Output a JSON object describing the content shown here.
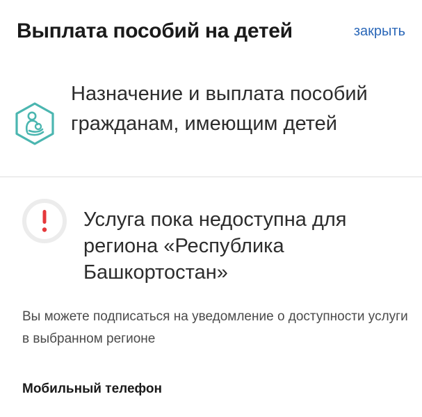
{
  "header": {
    "title": "Выплата пособий на детей",
    "close_label": "закрыть"
  },
  "service": {
    "icon": "mother-child-icon",
    "title": "Назначение и выплата пособий гражданам, имеющим детей"
  },
  "alert": {
    "icon": "exclamation-icon",
    "title": "Услуга пока недоступна для региона «Республика Башкортостан»"
  },
  "info": {
    "text": "Вы можете подписаться на уведомление о доступности услуги в выбранном регионе"
  },
  "form": {
    "phone_label": "Мобильный телефон"
  },
  "colors": {
    "accent": "#2a67b8",
    "icon_teal": "#4bb6b0",
    "alert_red": "#e5383b",
    "alert_circle": "#ececec"
  }
}
